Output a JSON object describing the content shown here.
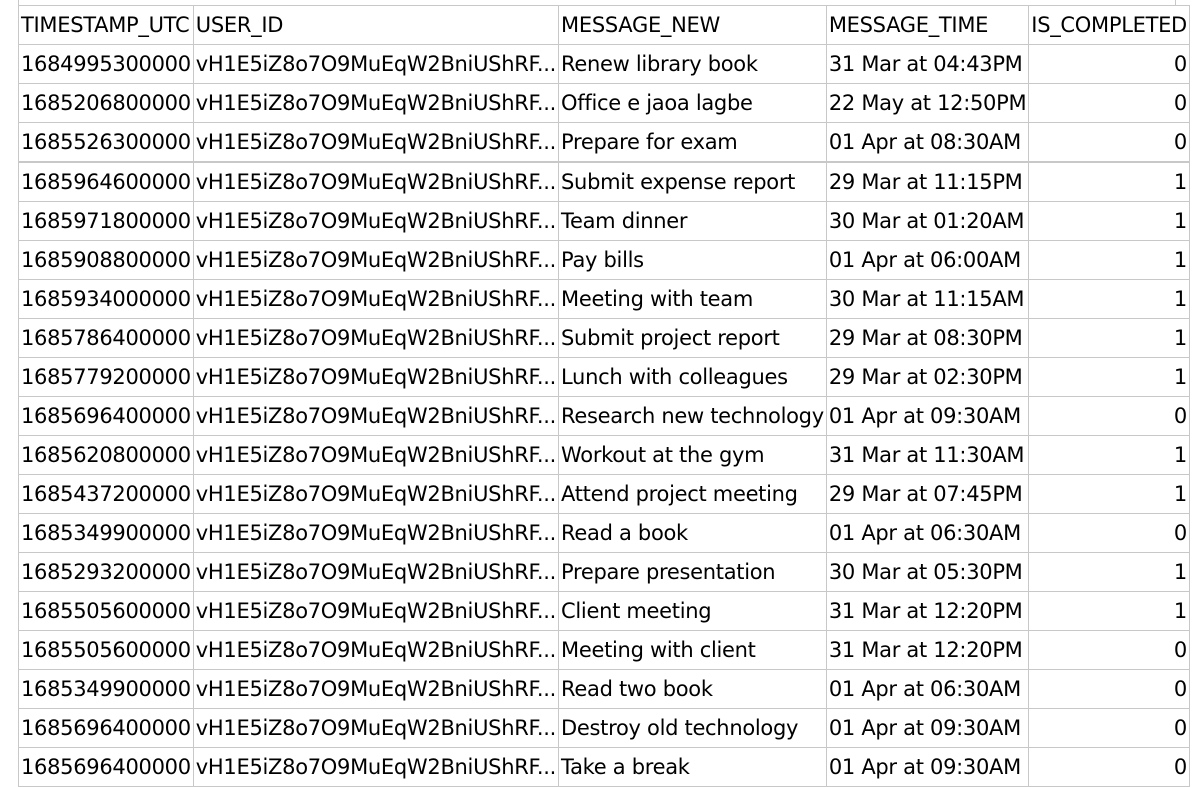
{
  "table": {
    "headers": {
      "timestamp": "TIMESTAMP_UTC",
      "user_id": "USER_ID",
      "message": "MESSAGE_NEW",
      "message_time": "MESSAGE_TIME",
      "completed": "IS_COMPLETED"
    },
    "rows": [
      [
        "1684995300000",
        "vH1E5iZ8o7O9MuEqW2BniUShRF...",
        "Renew library book",
        "31 Mar at 04:43PM",
        "0"
      ],
      [
        "1685206800000",
        "vH1E5iZ8o7O9MuEqW2BniUShRF...",
        "Office e jaoa lagbe",
        "22 May at 12:50PM",
        "0"
      ],
      [
        "1685526300000",
        "vH1E5iZ8o7O9MuEqW2BniUShRF...",
        "Prepare for exam",
        "01 Apr at 08:30AM",
        "0"
      ],
      [
        "1685964600000",
        "vH1E5iZ8o7O9MuEqW2BniUShRF...",
        "Submit expense report",
        "29 Mar at 11:15PM",
        "1"
      ],
      [
        "1685971800000",
        "vH1E5iZ8o7O9MuEqW2BniUShRF...",
        "Team dinner",
        "30 Mar at 01:20AM",
        "1"
      ],
      [
        "1685908800000",
        "vH1E5iZ8o7O9MuEqW2BniUShRF...",
        "Pay bills",
        "01 Apr at 06:00AM",
        "1"
      ],
      [
        "1685934000000",
        "vH1E5iZ8o7O9MuEqW2BniUShRF...",
        "Meeting with team",
        "30 Mar at 11:15AM",
        "1"
      ],
      [
        "1685786400000",
        "vH1E5iZ8o7O9MuEqW2BniUShRF...",
        "Submit project report",
        "29 Mar at 08:30PM",
        "1"
      ],
      [
        "1685779200000",
        "vH1E5iZ8o7O9MuEqW2BniUShRF...",
        "Lunch with colleagues",
        "29 Mar at 02:30PM",
        "1"
      ],
      [
        "1685696400000",
        "vH1E5iZ8o7O9MuEqW2BniUShRF...",
        "Research new technology",
        "01 Apr at 09:30AM",
        "0"
      ],
      [
        "1685620800000",
        "vH1E5iZ8o7O9MuEqW2BniUShRF...",
        "Workout at the gym",
        "31 Mar at 11:30AM",
        "1"
      ],
      [
        "1685437200000",
        "vH1E5iZ8o7O9MuEqW2BniUShRF...",
        "Attend project meeting",
        "29 Mar at 07:45PM",
        "1"
      ],
      [
        "1685349900000",
        "vH1E5iZ8o7O9MuEqW2BniUShRF...",
        "Read a book",
        "01 Apr at 06:30AM",
        "0"
      ],
      [
        "1685293200000",
        "vH1E5iZ8o7O9MuEqW2BniUShRF...",
        "Prepare presentation",
        "30 Mar at 05:30PM",
        "1"
      ],
      [
        "1685505600000",
        "vH1E5iZ8o7O9MuEqW2BniUShRF...",
        "Client meeting",
        "31 Mar at 12:20PM",
        "1"
      ],
      [
        "1685505600000",
        "vH1E5iZ8o7O9MuEqW2BniUShRF...",
        "Meeting with client",
        "31 Mar at 12:20PM",
        "0"
      ],
      [
        "1685349900000",
        "vH1E5iZ8o7O9MuEqW2BniUShRF...",
        "Read two book",
        "01 Apr at 06:30AM",
        "0"
      ],
      [
        "1685696400000",
        "vH1E5iZ8o7O9MuEqW2BniUShRF...",
        "Destroy old technology",
        "01 Apr at 09:30AM",
        "0"
      ],
      [
        "1685696400000",
        "vH1E5iZ8o7O9MuEqW2BniUShRF...",
        "Take a break",
        "01 Apr at 09:30AM",
        "0"
      ]
    ]
  },
  "colors": {
    "grid_line": "#c8c8c8",
    "background": "#ffffff",
    "text": "#000000"
  }
}
